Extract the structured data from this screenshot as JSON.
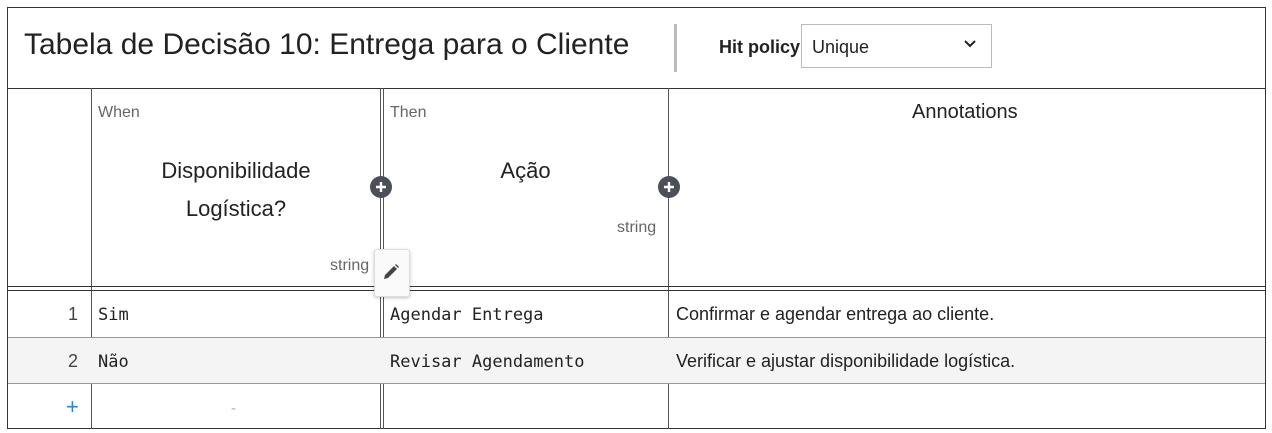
{
  "table": {
    "title": "Tabela de Decisão 10: Entrega para o Cliente",
    "hit_policy_label": "Hit policy:",
    "hit_policy_value": "Unique"
  },
  "columns": {
    "input": {
      "clause": "When",
      "name_line1": "Disponibilidade",
      "name_line2": "Logística?",
      "type": "string"
    },
    "output": {
      "clause": "Then",
      "name": "Ação",
      "type": "string"
    },
    "annotations": "Annotations"
  },
  "rows": [
    {
      "num": "1",
      "input": "Sim",
      "output": "Agendar Entrega",
      "annotation": "Confirmar e agendar entrega ao cliente."
    },
    {
      "num": "2",
      "input": "Não",
      "output": "Revisar Agendamento",
      "annotation": "Verificar e ajustar disponibilidade logística."
    }
  ],
  "add_row_label": "+",
  "empty_cell_placeholder": "-",
  "colors": {
    "accent": "#1e88e5",
    "border": "#333333",
    "alt_row": "#f4f4f4",
    "add_button": "#4a4f58"
  },
  "icons": {
    "hit_policy_dropdown": "chevron-down-icon",
    "add_column": "plus-icon",
    "edit": "pencil-icon"
  }
}
